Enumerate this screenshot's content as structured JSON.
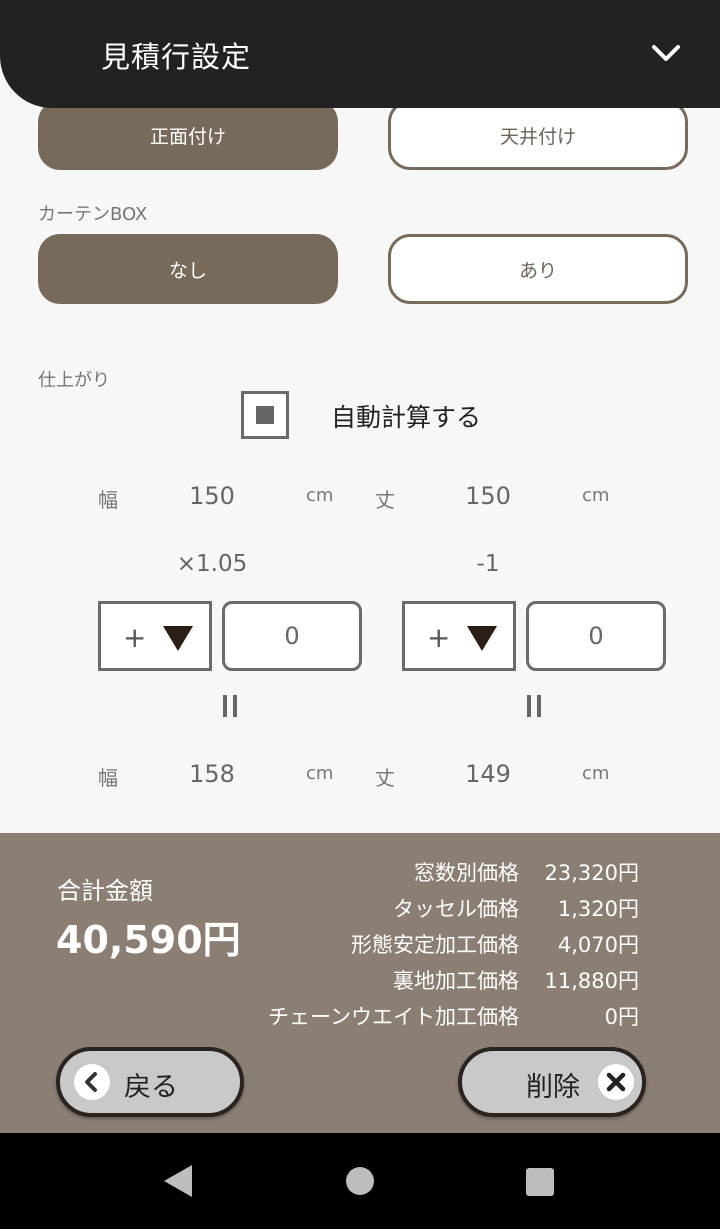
{
  "header": {
    "title": "見積行設定",
    "collapse_icon": "chevron-down-icon"
  },
  "mount": {
    "options": [
      {
        "label": "正面付け",
        "selected": true
      },
      {
        "label": "天井付け",
        "selected": false
      }
    ]
  },
  "curtain_box": {
    "label": "カーテンBOX",
    "options": [
      {
        "label": "なし",
        "selected": true
      },
      {
        "label": "あり",
        "selected": false
      }
    ]
  },
  "finish": {
    "label": "仕上がり",
    "auto_calc": {
      "label": "自動計算する",
      "checked": true
    },
    "width": {
      "label": "幅",
      "input": "150",
      "unit": "cm",
      "factor": "×1.05",
      "sign": "+",
      "adjust": "0",
      "result": "158"
    },
    "height": {
      "label": "丈",
      "input": "150",
      "unit": "cm",
      "factor": "-1",
      "sign": "+",
      "adjust": "0",
      "result": "149"
    }
  },
  "summary": {
    "total_label": "合計金額",
    "total_value": "40,590円",
    "breakdown": [
      {
        "label": "窓数別価格",
        "value": "23,320円"
      },
      {
        "label": "タッセル価格",
        "value": "1,320円"
      },
      {
        "label": "形態安定加工価格",
        "value": "4,070円"
      },
      {
        "label": "裏地加工価格",
        "value": "11,880円"
      },
      {
        "label": "チェーンウエイト加工価格",
        "value": "0円"
      }
    ]
  },
  "actions": {
    "back_label": "戻る",
    "delete_label": "削除"
  },
  "colors": {
    "header_bg": "#222222",
    "accent": "#776a5a",
    "footer_bg": "#8b7f74"
  }
}
